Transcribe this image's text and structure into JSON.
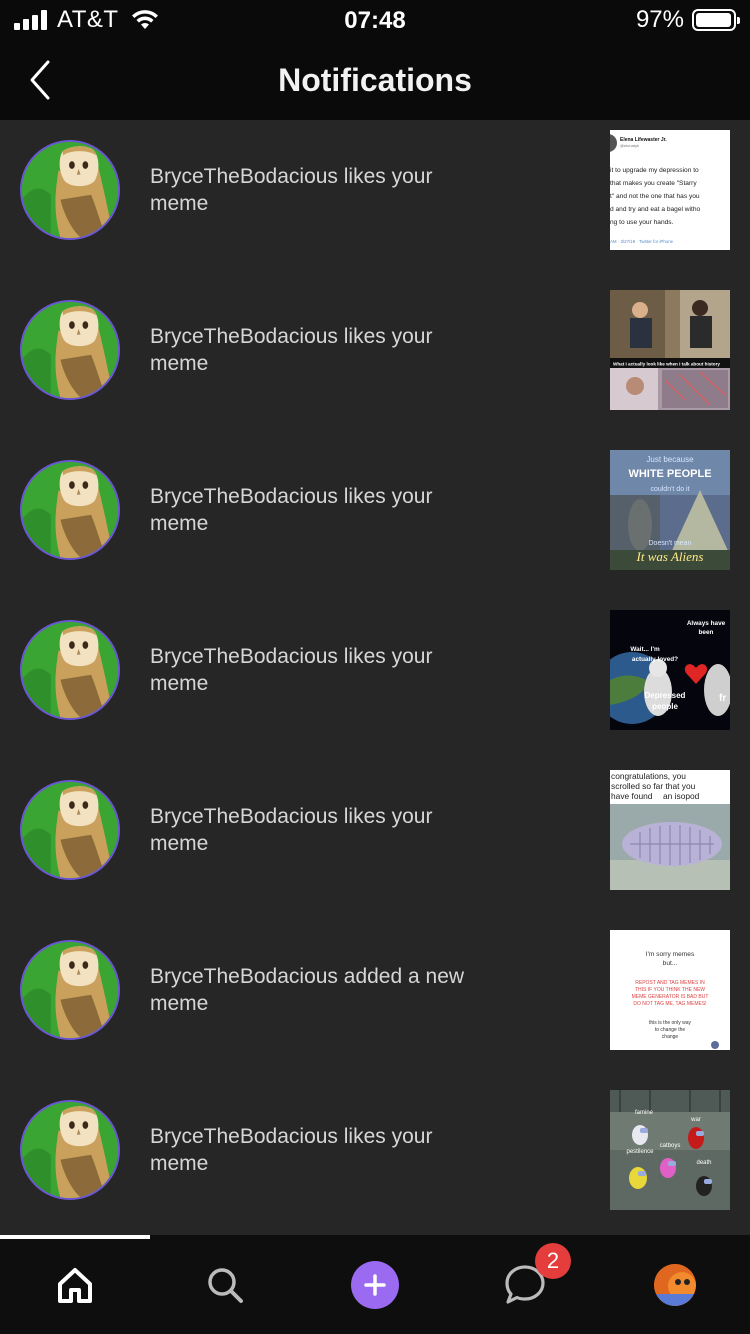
{
  "status_bar": {
    "carrier": "AT&T",
    "time": "07:48",
    "battery_percent": "97%",
    "battery_level": 0.97,
    "signal_icon": "signal-bars-icon",
    "wifi_icon": "wifi-icon"
  },
  "header": {
    "title": "Notifications",
    "back_icon": "chevron-left-icon"
  },
  "notifications": [
    {
      "text": "BryceTheBodacious likes your meme",
      "thumb_type": "tweet",
      "thumb_text": {
        "name": "Elena Lifewaster Jr.",
        "handle": "@elunatyk",
        "lines": [
          "it to upgrade my depression to",
          "that makes you create \"Starry",
          "t\" and not the one that has you",
          "d and try and eat a bagel witho",
          "ng to use your hands."
        ],
        "footer": "AM · 3/27/19 · Twitter for iPhone"
      }
    },
    {
      "text": "BryceTheBodacious likes your meme",
      "thumb_type": "photo-talk",
      "thumb_text": {
        "caption": "What I actually look like when I talk about history"
      }
    },
    {
      "text": "BryceTheBodacious likes your meme",
      "thumb_type": "aliens",
      "thumb_text": {
        "line1": "Just because",
        "line2": "WHITE PEOPLE",
        "line3": "couldn't do it",
        "line4": "Doesn't mean",
        "line5": "It was Aliens"
      }
    },
    {
      "text": "BryceTheBodacious likes your meme",
      "thumb_type": "astronaut",
      "thumb_text": {
        "top1": "Always have",
        "top2": "been",
        "mid1": "Wait... I'm",
        "mid2": "actually loved?",
        "bot1": "Depressed",
        "bot2": "people",
        "edge": "fr"
      }
    },
    {
      "text": "BryceTheBodacious likes your meme",
      "thumb_type": "isopod",
      "thumb_text": {
        "line1": "congratulations, you",
        "line2": "scrolled so far that you",
        "line3": "have found",
        "line3b": "an isopod"
      }
    },
    {
      "text": "BryceTheBodacious added a new meme",
      "thumb_type": "sorry",
      "thumb_text": {
        "l1": "I'm sorry memes",
        "l2": "but...",
        "r1": "REPOST AND TAG MEMES IN",
        "r2": "THIS IF YOU THINK THE NEW",
        "r3": "MEME GENERATOR IS BAD BUT",
        "r4": "DO NOT TAG ME, TAG MEMES!",
        "b1": "this is the only way",
        "b2": "to change the",
        "b3": "change"
      }
    },
    {
      "text": "BryceTheBodacious likes your meme",
      "thumb_type": "amongus",
      "thumb_text": {
        "famine": "famine",
        "war": "war",
        "pestilence": "pestilence",
        "catboys": "catboys",
        "death": "death"
      }
    }
  ],
  "tab_bar": {
    "active_tab": "home",
    "tabs": [
      {
        "id": "home",
        "icon": "home-icon"
      },
      {
        "id": "search",
        "icon": "search-icon"
      },
      {
        "id": "add",
        "icon": "plus-icon"
      },
      {
        "id": "messages",
        "icon": "chat-bubble-icon",
        "badge": "2"
      },
      {
        "id": "profile",
        "icon": "profile-avatar"
      }
    ]
  },
  "colors": {
    "background": "#262626",
    "bar_background": "#0a0a0a",
    "accent_purple": "#9a6af0",
    "avatar_ring": "#6b57d6",
    "badge_red": "#e53c3c",
    "text_secondary": "#d6d6d6"
  }
}
